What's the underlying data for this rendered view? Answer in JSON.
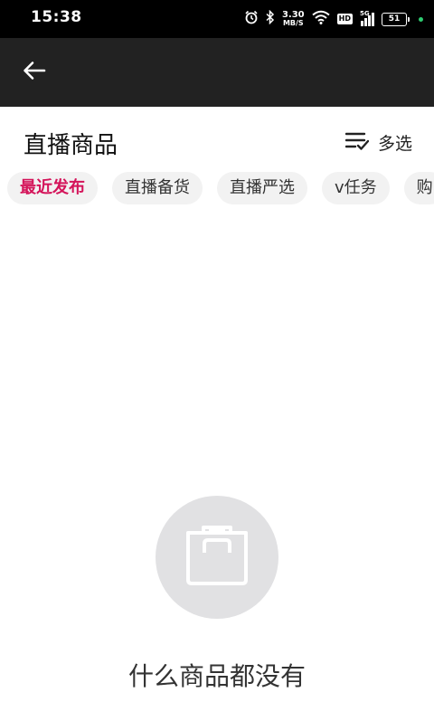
{
  "status_bar": {
    "time": "15:38",
    "net_speed_value": "3.30",
    "net_speed_unit": "MB/S",
    "hd_label": "HD",
    "signal_label": "5G",
    "battery": "51",
    "icons": [
      "alarm-icon",
      "bluetooth-icon",
      "wifi-icon",
      "hd-icon",
      "signal-icon",
      "battery-icon"
    ]
  },
  "toolbar": {
    "back_icon": "arrow-left-icon"
  },
  "header": {
    "title": "直播商品",
    "multi_select_label": "多选",
    "multi_select_icon": "checklist-icon"
  },
  "filters": {
    "active_color": "#d4145a",
    "chips": [
      {
        "label": "最近发布",
        "active": true
      },
      {
        "label": "直播备货",
        "active": false
      },
      {
        "label": "直播严选",
        "active": false
      },
      {
        "label": "v任务",
        "active": false
      },
      {
        "label": "购",
        "active": false
      }
    ]
  },
  "empty_state": {
    "icon": "shopping-bag-icon",
    "message": "什么商品都没有"
  }
}
